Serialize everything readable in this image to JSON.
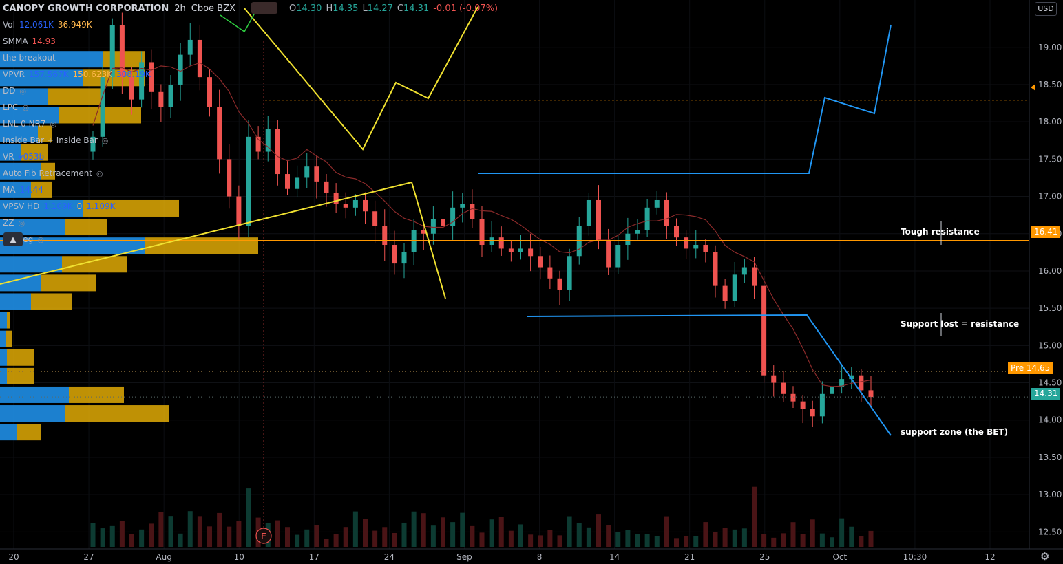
{
  "header": {
    "symbol": "CANOPY GROWTH CORPORATION",
    "interval": "2h",
    "exchange": "Cboe BZX",
    "ohlc": {
      "o_label": "O",
      "o": "14.30",
      "h_label": "H",
      "h": "14.35",
      "l_label": "L",
      "l": "14.27",
      "c_label": "C",
      "c": "14.31",
      "change": "-0.01 (-0.07%)"
    }
  },
  "indicators": [
    {
      "name": "Vol",
      "v1": "12.061K",
      "v2": "36.949K"
    },
    {
      "name": "SMMA",
      "v1": "14.93"
    },
    {
      "name": "the breakout"
    },
    {
      "name": "VPVR",
      "v1": "157.567K",
      "v2": "150.623K",
      "v3": "308.19K"
    },
    {
      "name": "DD",
      "eye": true
    },
    {
      "name": "LPC",
      "eye": true
    },
    {
      "name": "LNL 0 NR7",
      "eye": true
    },
    {
      "name": "Inside Bar + Inside Bar",
      "eye": true
    },
    {
      "name": "VR",
      "v1": "v053b"
    },
    {
      "name": "Auto Fib Retracement",
      "eye": true
    },
    {
      "name": "MA",
      "v1": "14.44"
    },
    {
      "name": "VPSV HD",
      "v1": "1.109K",
      "v2": "0",
      "v3": "1.109K"
    },
    {
      "name": "ZZ",
      "eye": true
    },
    {
      "name": "Lin Reg",
      "eye": true
    }
  ],
  "toolbar": {
    "collapse_icon": "chevron-up-icon",
    "currency": "USD",
    "settings_icon": "gear-icon"
  },
  "annotations": {
    "tough_resistance": "Tough resistance",
    "support_lost": "Support lost = resistance",
    "support_zone": "support zone (the BET)"
  },
  "price_tags": {
    "current": "14.31",
    "pre_label": "Pre",
    "pre": "14.65",
    "level": "16.41"
  },
  "earnings_marker": "E",
  "colors": {
    "up": "#26a69a",
    "down": "#ef5350",
    "yellow": "#f0e130",
    "blue": "#2196f3",
    "orange": "#ff9800",
    "vp_blue": "#2196f3",
    "vp_gold": "#ffc107"
  },
  "chart_data": {
    "type": "candlestick",
    "y_axis_ticks": [
      12.5,
      13,
      13.5,
      14,
      14.5,
      15,
      15.5,
      16,
      16.5,
      17,
      17.5,
      18,
      18.5,
      19
    ],
    "ylim": [
      12.3,
      19.45
    ],
    "x_axis_ticks": [
      "20",
      "27",
      "Aug",
      "10",
      "17",
      "24",
      "Sep",
      "8",
      "14",
      "21",
      "25",
      "Oct",
      "10:30",
      "12"
    ],
    "close_path": [
      17.8,
      18.6,
      19.3,
      18.6,
      18.3,
      18.8,
      18.4,
      18.2,
      18.5,
      18.9,
      19.1,
      18.6,
      18.2,
      17.5,
      17.0,
      16.6,
      17.8,
      17.6,
      17.9,
      17.3,
      17.1,
      17.25,
      17.4,
      17.2,
      17.05,
      16.9,
      16.85,
      16.95,
      16.8,
      16.6,
      16.35,
      16.1,
      16.25,
      16.55,
      16.5,
      16.7,
      16.6,
      16.85,
      16.9,
      16.7,
      16.35,
      16.45,
      16.3,
      16.25,
      16.3,
      16.2,
      16.05,
      15.9,
      15.75,
      16.2,
      16.6,
      16.95,
      16.4,
      16.05,
      16.35,
      16.5,
      16.55,
      16.85,
      16.95,
      16.6,
      16.45,
      16.3,
      16.35,
      16.25,
      15.8,
      15.6,
      15.95,
      16.05,
      15.8,
      14.6,
      14.5,
      14.35,
      14.25,
      14.15,
      14.05,
      14.35,
      14.45,
      14.55,
      14.6,
      14.4,
      14.31
    ],
    "key_levels": [
      {
        "name": "Tough resistance",
        "value": 16.41
      },
      {
        "name": "Pre",
        "value": 14.65
      },
      {
        "name": "Last",
        "value": 14.31
      },
      {
        "name": "Horizontal ray",
        "value": 18.29
      }
    ]
  }
}
